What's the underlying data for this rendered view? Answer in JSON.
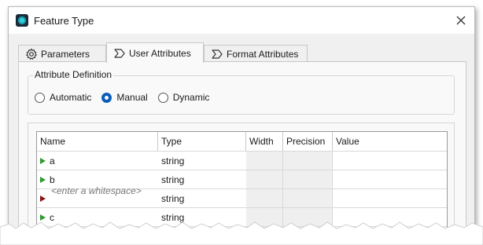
{
  "window": {
    "title": "Feature Type"
  },
  "tabs": [
    {
      "label": "Parameters",
      "icon": "gear-icon",
      "active": false
    },
    {
      "label": "User Attributes",
      "icon": "sigma-icon",
      "active": true
    },
    {
      "label": "Format Attributes",
      "icon": "sigma-icon",
      "active": false
    }
  ],
  "attribute_definition": {
    "label": "Attribute Definition",
    "options": [
      {
        "label": "Automatic",
        "checked": false
      },
      {
        "label": "Manual",
        "checked": true
      },
      {
        "label": "Dynamic",
        "checked": false
      }
    ]
  },
  "table": {
    "columns": [
      "Name",
      "Type",
      "Width",
      "Precision",
      "Value"
    ],
    "rows": [
      {
        "name": "a",
        "type": "string",
        "status": "green"
      },
      {
        "name": "b",
        "type": "string",
        "status": "green"
      },
      {
        "name": "",
        "placeholder": "<enter a whitespace>",
        "type": "string",
        "status": "red"
      },
      {
        "name": "c",
        "type": "string",
        "status": "green"
      }
    ]
  },
  "colors": {
    "accent": "#0b5fb8",
    "status_green": "#2e9b2e",
    "status_red": "#8b1414"
  }
}
